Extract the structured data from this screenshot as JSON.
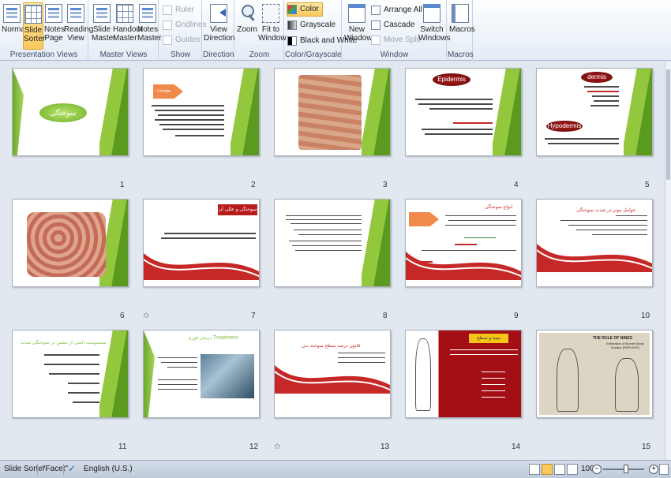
{
  "ribbon": {
    "groups": {
      "presentation_views": "Presentation Views",
      "master_views": "Master Views",
      "show": "Show",
      "direction": "Direction",
      "zoom": "Zoom",
      "color_grayscale": "Color/Grayscale",
      "window": "Window",
      "macros": "Macros"
    },
    "buttons": {
      "normal": "Normal",
      "slide_sorter": "Slide Sorter",
      "notes_page": "Notes Page",
      "reading_view": "Reading View",
      "slide_master": "Slide Master",
      "handout_master": "Handout Master",
      "notes_master": "Notes Master",
      "ruler": "Ruler",
      "gridlines": "Gridlines",
      "guides": "Guides",
      "view_direction": "View Direction",
      "zoom": "Zoom",
      "fit_to_window": "Fit to Window",
      "color": "Color",
      "grayscale": "Grayscale",
      "black_and_white": "Black and White",
      "new_window": "New Window",
      "arrange_all": "Arrange All",
      "cascade": "Cascade",
      "move_split": "Move Split",
      "switch_windows": "Switch Windows",
      "macros": "Macros"
    }
  },
  "slides": {
    "s1": {
      "num": "1",
      "title": "سوختگی"
    },
    "s2": {
      "num": "2",
      "title": "پوست"
    },
    "s3": {
      "num": "3"
    },
    "s4": {
      "num": "4",
      "title": "Epidermis"
    },
    "s5": {
      "num": "5",
      "title": "dermis",
      "title2": "Hypodermis"
    },
    "s6": {
      "num": "6"
    },
    "s7": {
      "num": "7",
      "title": "سوختگی و عللی آن"
    },
    "s8": {
      "num": "8"
    },
    "s9": {
      "num": "9",
      "title": "انواع سوختگی"
    },
    "s10": {
      "num": "10",
      "title": "عوامل موثر در شدت سوختگی"
    },
    "s11": {
      "num": "11",
      "title": "مسمومیت ناشی از تنفس در سوختگی شدید"
    },
    "s12": {
      "num": "12",
      "title": "درمان فوری",
      "title_en": "Treatment"
    },
    "s13": {
      "num": "13",
      "title": "قانون درصد سطح سوخته بدن"
    },
    "s14": {
      "num": "14",
      "title": "بیمه و سطح سوختگی"
    },
    "s15": {
      "num": "15",
      "title": "THE RULE OF NINES",
      "sub": "Estimation of Burned Body Surface [PERCENT]"
    }
  },
  "status": {
    "view": "Slide Sorter",
    "theme": "\"Facet\"",
    "language": "English (U.S.)",
    "zoom": "100%"
  }
}
